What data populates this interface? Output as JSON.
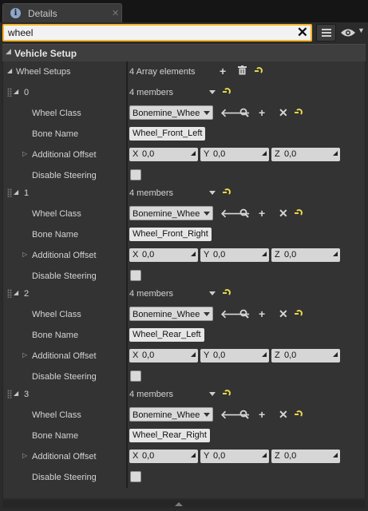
{
  "tab": {
    "title": "Details",
    "icon": "info-icon",
    "close_icon": "close-icon"
  },
  "search": {
    "value": "wheel",
    "clear_icon": "close-icon"
  },
  "toolbar": {
    "list_view_icon": "list-view-icon",
    "visibility_icon": "eye-icon"
  },
  "category": {
    "label": "Vehicle Setup"
  },
  "wheel_setups": {
    "label": "Wheel Setups",
    "count_text": "4 Array elements"
  },
  "elements": [
    {
      "index": "0",
      "members": "4 members",
      "wheel_class_label": "Wheel Class",
      "wheel_class": "Bonemine_Wheel",
      "bone_name_label": "Bone Name",
      "bone_name": "Wheel_Front_Left",
      "offset_label": "Additional Offset",
      "x_axis": "X",
      "x": "0,0",
      "y_axis": "Y",
      "y": "0,0",
      "z_axis": "Z",
      "z": "0,0",
      "disable_label": "Disable Steering"
    },
    {
      "index": "1",
      "members": "4 members",
      "wheel_class_label": "Wheel Class",
      "wheel_class": "Bonemine_Wheel",
      "bone_name_label": "Bone Name",
      "bone_name": "Wheel_Front_Right",
      "offset_label": "Additional Offset",
      "x_axis": "X",
      "x": "0,0",
      "y_axis": "Y",
      "y": "0,0",
      "z_axis": "Z",
      "z": "0,0",
      "disable_label": "Disable Steering"
    },
    {
      "index": "2",
      "members": "4 members",
      "wheel_class_label": "Wheel Class",
      "wheel_class": "Bonemine_Wheel",
      "bone_name_label": "Bone Name",
      "bone_name": "Wheel_Rear_Left",
      "offset_label": "Additional Offset",
      "x_axis": "X",
      "x": "0,0",
      "y_axis": "Y",
      "y": "0,0",
      "z_axis": "Z",
      "z": "0,0",
      "disable_label": "Disable Steering"
    },
    {
      "index": "3",
      "members": "4 members",
      "wheel_class_label": "Wheel Class",
      "wheel_class": "Bonemine_Wheel",
      "bone_name_label": "Bone Name",
      "bone_name": "Wheel_Rear_Right",
      "offset_label": "Additional Offset",
      "x_axis": "X",
      "x": "0,0",
      "y_axis": "Y",
      "y": "0,0",
      "z_axis": "Z",
      "z": "0,0",
      "disable_label": "Disable Steering"
    }
  ],
  "colors": {
    "accent": "#f5b625",
    "reset": "#e8d64a",
    "panel": "#333333"
  }
}
